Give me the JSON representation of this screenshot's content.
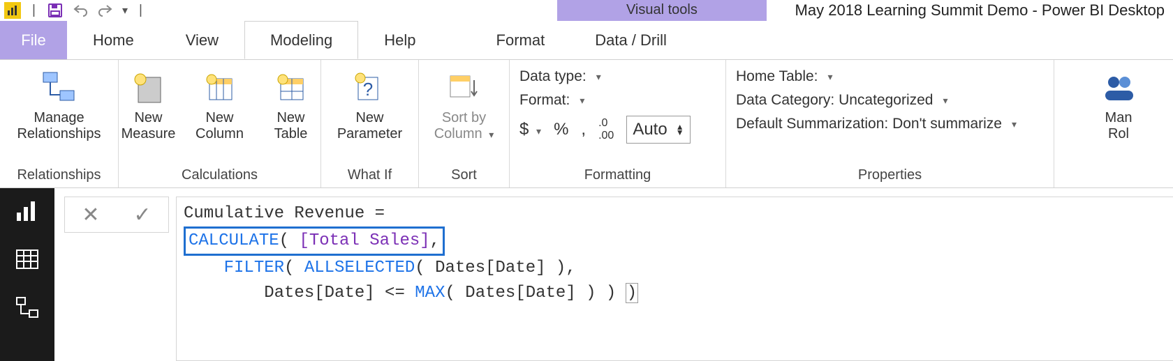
{
  "title": {
    "context_tab": "Visual tools",
    "app_title": "May 2018 Learning Summit Demo - Power BI Desktop"
  },
  "tabs": {
    "file": "File",
    "items": [
      "Home",
      "View",
      "Modeling",
      "Help"
    ],
    "context": [
      "Format",
      "Data / Drill"
    ],
    "active_index": 2
  },
  "ribbon": {
    "relationships": {
      "label": "Relationships",
      "manage": "Manage\nRelationships"
    },
    "calculations": {
      "label": "Calculations",
      "measure": "New\nMeasure",
      "column": "New\nColumn",
      "table": "New\nTable"
    },
    "whatif": {
      "label": "What If",
      "param": "New\nParameter"
    },
    "sort": {
      "label": "Sort",
      "sortby": "Sort by\nColumn"
    },
    "formatting": {
      "label": "Formatting",
      "data_type": "Data type:",
      "format": "Format:",
      "currency": "$",
      "percent": "%",
      "comma": ",",
      "decimals_icon": ".00",
      "decimals_value": "Auto"
    },
    "properties": {
      "label": "Properties",
      "home_table": "Home Table:",
      "data_category": "Data Category: Uncategorized",
      "default_summ": "Default Summarization: Don't summarize"
    },
    "security": {
      "label_l1": "Man",
      "label_l2": "Rol"
    }
  },
  "formula": {
    "line1_prefix": "Cumulative Revenue = ",
    "line2_fn": "CALCULATE",
    "line2_open": "(",
    "line2_col": "[Total Sales]",
    "line2_tail": ",",
    "line3_indent": "    ",
    "line3_fn1": "FILTER",
    "line3_mid": "( ",
    "line3_fn2": "ALLSELECTED",
    "line3_tail": "( Dates[Date] ),",
    "line4_indent": "        ",
    "line4_a": "Dates[Date] <= ",
    "line4_fn": "MAX",
    "line4_b": "( Dates[Date] ) ) ",
    "line4_close": ")"
  }
}
